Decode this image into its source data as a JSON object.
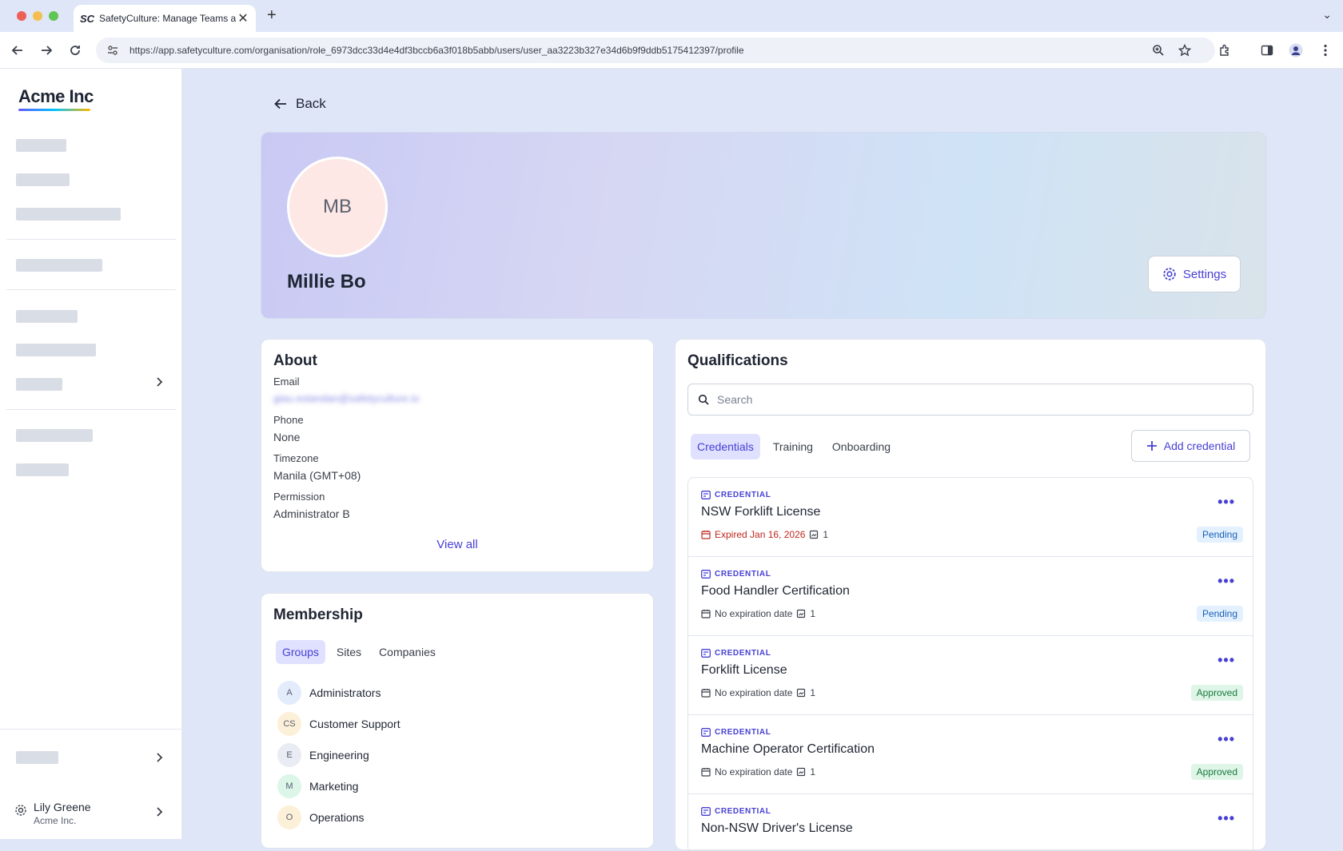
{
  "browser": {
    "tab_title": "SafetyCulture: Manage Teams and...",
    "tab_favicon_text": "SC",
    "url": "https://app.safetyculture.com/organisation/role_6973dcc33d4e4df3bccb6a3f018b5abb/users/user_aa3223b327e34d6b9f9ddb5175412397/profile"
  },
  "sidebar": {
    "logo": "Acme Inc",
    "user": {
      "name": "Lily Greene",
      "org": "Acme Inc."
    }
  },
  "main": {
    "back_label": "Back",
    "profile": {
      "initials": "MB",
      "name": "Millie Bo",
      "settings_label": "Settings"
    },
    "about": {
      "title": "About",
      "email_label": "Email",
      "email_value": "giau.estandan@safetyculture.io",
      "phone_label": "Phone",
      "phone_value": "None",
      "timezone_label": "Timezone",
      "timezone_value": "Manila (GMT+08)",
      "permission_label": "Permission",
      "permission_value": "Administrator B",
      "view_all": "View all"
    },
    "membership": {
      "title": "Membership",
      "tabs": [
        "Groups",
        "Sites",
        "Companies"
      ],
      "active_tab": "Groups",
      "groups": [
        {
          "initials": "A",
          "name": "Administrators",
          "color": "#e3ecfb"
        },
        {
          "initials": "CS",
          "name": "Customer Support",
          "color": "#fdf0d8"
        },
        {
          "initials": "E",
          "name": "Engineering",
          "color": "#e9ecf2"
        },
        {
          "initials": "M",
          "name": "Marketing",
          "color": "#dcf6ea"
        },
        {
          "initials": "O",
          "name": "Operations",
          "color": "#fdf0d8"
        }
      ]
    },
    "qualifications": {
      "title": "Qualifications",
      "search_placeholder": "Search",
      "tabs": [
        "Credentials",
        "Training",
        "Onboarding"
      ],
      "active_tab": "Credentials",
      "add_label": "Add credential",
      "items": [
        {
          "type": "CREDENTIAL",
          "name": "NSW Forklift License",
          "expiry": "Expired Jan 16, 2026",
          "expired": true,
          "count": "1",
          "status": "Pending"
        },
        {
          "type": "CREDENTIAL",
          "name": "Food Handler Certification",
          "expiry": "No expiration date",
          "expired": false,
          "count": "1",
          "status": "Pending"
        },
        {
          "type": "CREDENTIAL",
          "name": "Forklift License",
          "expiry": "No expiration date",
          "expired": false,
          "count": "1",
          "status": "Approved"
        },
        {
          "type": "CREDENTIAL",
          "name": "Machine Operator Certification",
          "expiry": "No expiration date",
          "expired": false,
          "count": "1",
          "status": "Approved"
        },
        {
          "type": "CREDENTIAL",
          "name": "Non-NSW Driver's License",
          "expiry": "",
          "expired": false,
          "count": "",
          "status": ""
        }
      ]
    }
  },
  "colors": {
    "accent": "#4740d4",
    "expired": "#c0281f",
    "pending_bg": "#e3f1ff",
    "approved_bg": "#dff5e8"
  }
}
